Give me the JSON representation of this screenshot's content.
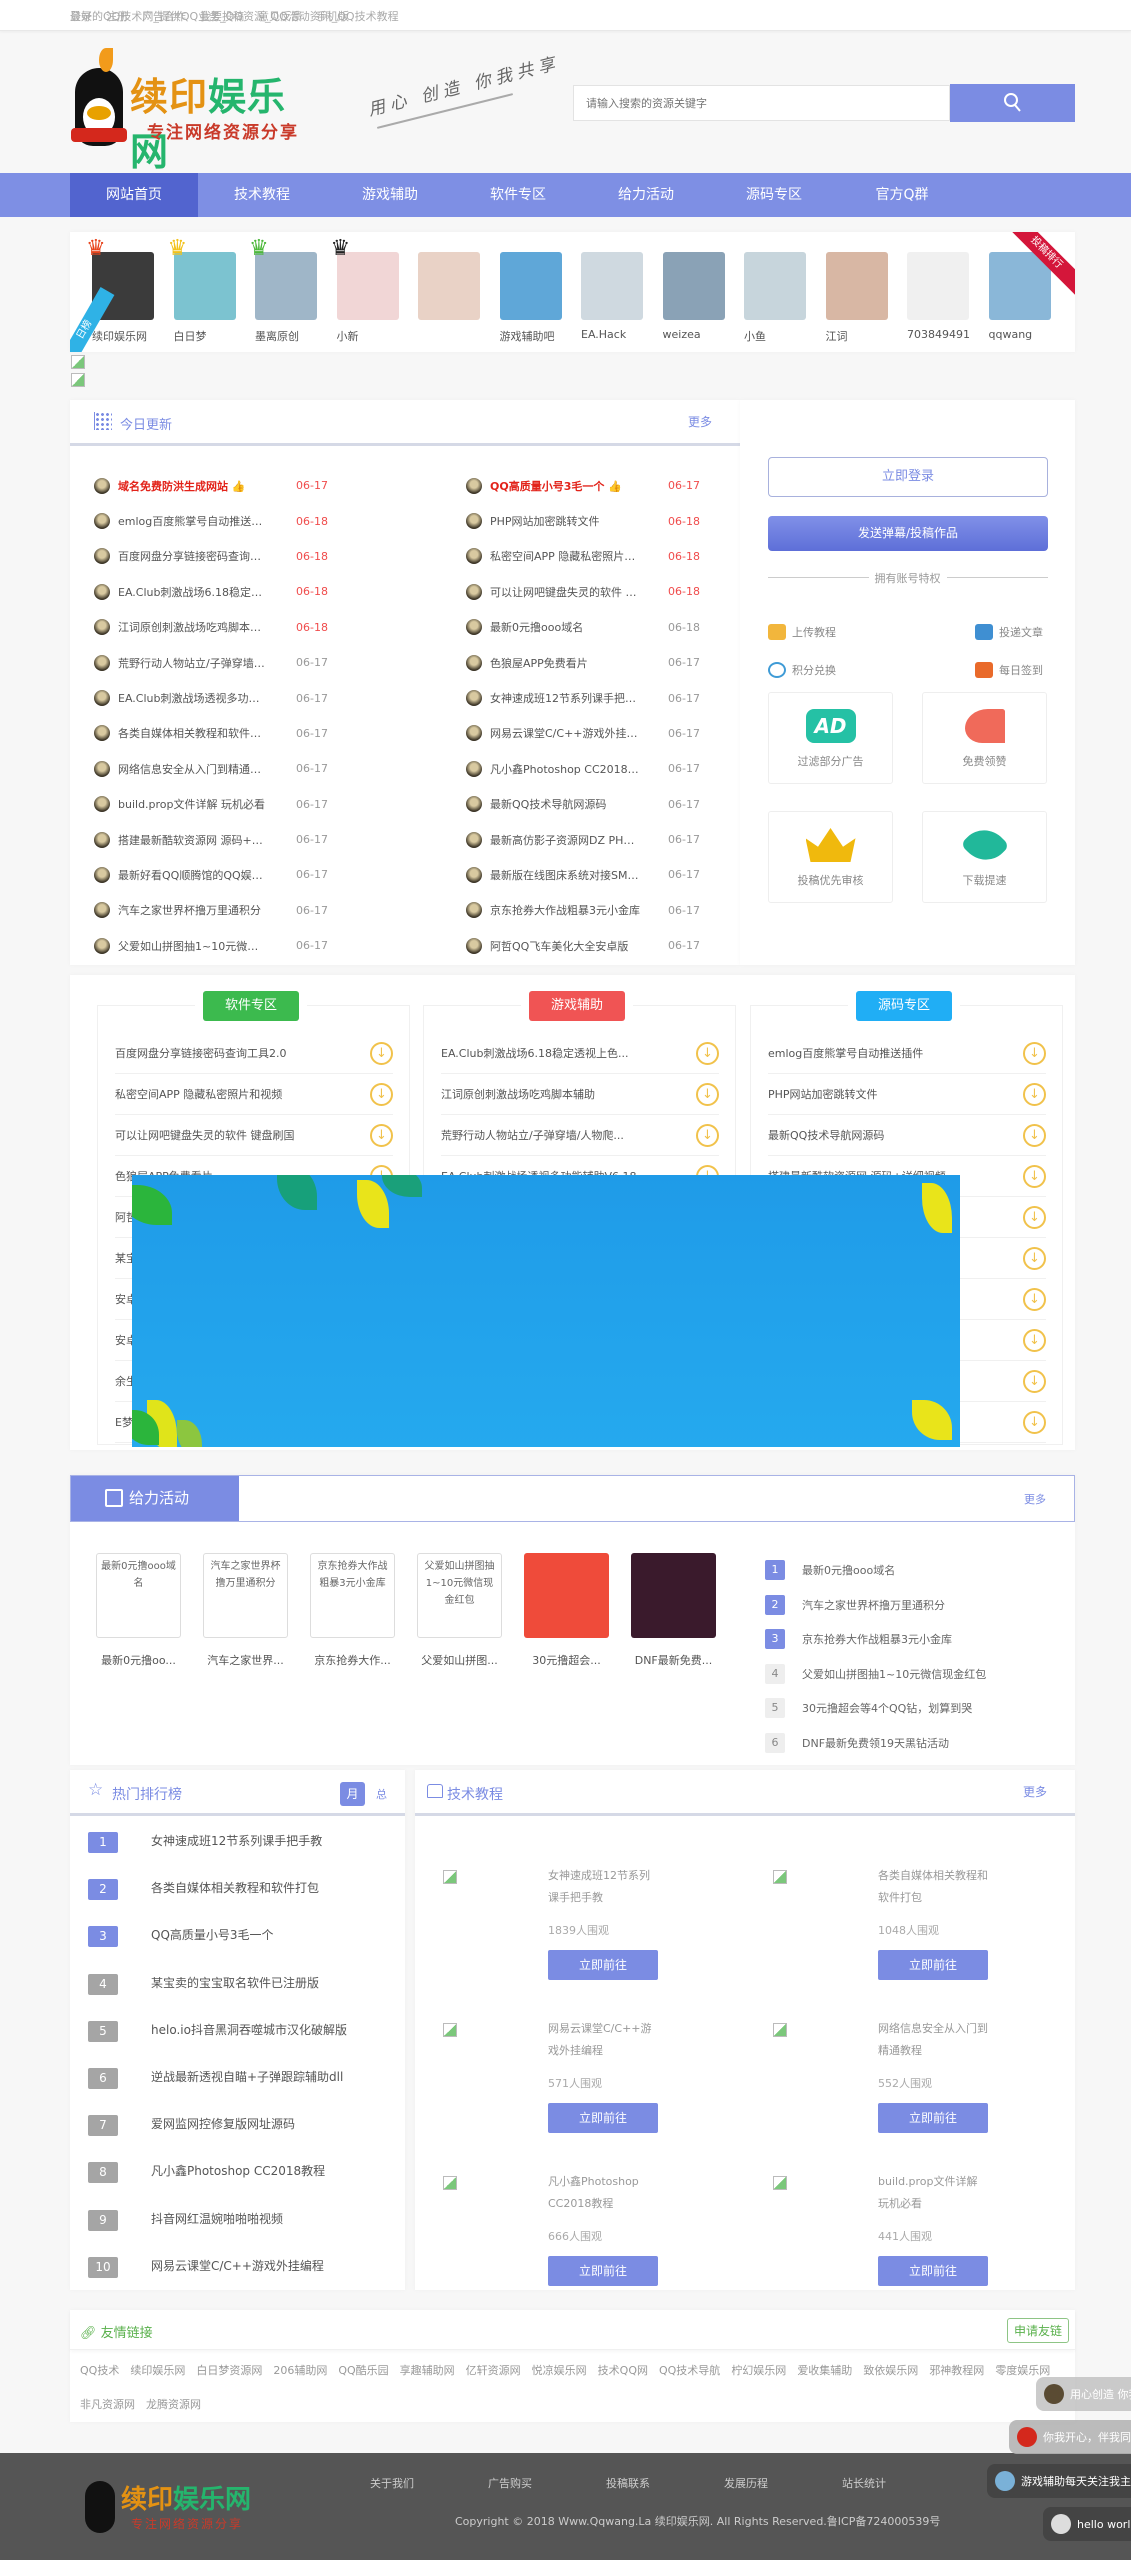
{
  "topbar": {
    "tagline": "最好的QQ技术网_提供QQ业务_QQ资源_QQ活动资讯_QQ技术教程",
    "links": [
      "登录",
      "注册",
      "广告合作",
      "我要投稿",
      "意见反馈",
      "手机版"
    ]
  },
  "header": {
    "logo_name": "续印娱乐网",
    "logo_sub": "专注网络资源分享",
    "slogan": "用心 创造 你我共享",
    "search_placeholder": "请输入搜索的资源关键字",
    "search_icon": "search-icon"
  },
  "nav": [
    "网站首页",
    "技术教程",
    "游戏辅助",
    "软件专区",
    "给力活动",
    "源码专区",
    "官方Q群"
  ],
  "colors": {
    "accent": "#7b8ce3",
    "nav_active": "#5264cf",
    "hot": "#e2231a",
    "software": "#3cba4e",
    "game": "#f05454",
    "source": "#20aef5"
  },
  "avatars": {
    "ribbon_right": "投稿排行",
    "ribbon_left": "日榜",
    "users": [
      {
        "name": "续印娱乐网"
      },
      {
        "name": "白日梦"
      },
      {
        "name": "墨离原创"
      },
      {
        "name": "小新"
      },
      {
        "name": ""
      },
      {
        "name": "游戏辅助吧"
      },
      {
        "name": "EA.Hack"
      },
      {
        "name": "weizea"
      },
      {
        "name": "小鱼"
      },
      {
        "name": "江词"
      },
      {
        "name": "703849491"
      },
      {
        "name": "qqwang"
      }
    ]
  },
  "today": {
    "title": "今日更新",
    "more": "更多",
    "left": [
      {
        "title": "域名免费防洪生成网站 👍",
        "date": "06-17",
        "hot": true,
        "red": true
      },
      {
        "title": "emlog百度熊掌号自动推送插件",
        "date": "06-18",
        "red": true
      },
      {
        "title": "百度网盘分享链接密码查询工具...",
        "date": "06-18",
        "red": true
      },
      {
        "title": "EA.Club刺激战场6.18稳定透视...",
        "date": "06-18",
        "red": true
      },
      {
        "title": "江词原创刺激战场吃鸡脚本辅助",
        "date": "06-18",
        "red": true
      },
      {
        "title": "荒野行动人物站立/子弹穿墙/人...",
        "date": "06-17"
      },
      {
        "title": "EA.Club刺激战场透视多功能辅...",
        "date": "06-17"
      },
      {
        "title": "各类自媒体相关教程和软件打包",
        "date": "06-17"
      },
      {
        "title": "网络信息安全从入门到精通教程",
        "date": "06-17"
      },
      {
        "title": "build.prop文件详解 玩机必看",
        "date": "06-17"
      },
      {
        "title": "搭建最新酷软资源网 源码+详细...",
        "date": "06-17"
      },
      {
        "title": "最新好看QQ顺腾馆的QQ娱乐...",
        "date": "06-17"
      },
      {
        "title": "汽车之家世界杯撸万里通积分",
        "date": "06-17"
      },
      {
        "title": "父爱如山拼图抽1~10元微信现...",
        "date": "06-17"
      }
    ],
    "right": [
      {
        "title": "QQ高质量小号3毛一个 👍",
        "date": "06-17",
        "hot": true,
        "red": true
      },
      {
        "title": "PHP网站加密跳转文件",
        "date": "06-18",
        "red": true
      },
      {
        "title": "私密空间APP 隐藏私密照片和...",
        "date": "06-18",
        "red": true
      },
      {
        "title": "可以让网吧键盘失灵的软件 键...",
        "date": "06-18",
        "red": true
      },
      {
        "title": "最新0元撸ooo域名",
        "date": "06-18"
      },
      {
        "title": "色狼屋APP免费看片",
        "date": "06-17"
      },
      {
        "title": "女神速成班12节系列课手把手教",
        "date": "06-17"
      },
      {
        "title": "网易云课堂C/C++游戏外挂编程",
        "date": "06-17"
      },
      {
        "title": "凡小鑫Photoshop CC2018教程",
        "date": "06-17"
      },
      {
        "title": "最新QQ技术导航网源码",
        "date": "06-17"
      },
      {
        "title": " 最新高仿影子资源网DZ PHP源码",
        "date": "06-17"
      },
      {
        "title": "最新版在线图床系统对接SM.M...",
        "date": "06-17"
      },
      {
        "title": "京东抢券大作战粗暴3元小金库",
        "date": "06-17"
      },
      {
        "title": "阿哲QQ飞车美化大全安卓版",
        "date": "06-17"
      }
    ]
  },
  "account": {
    "login": "立即登录",
    "post": "发送弹幕/投稿作品",
    "privilege_title": "拥有账号特权",
    "perks": [
      "上传教程",
      "投递文章",
      "积分兑换",
      "每日签到"
    ],
    "cards": [
      "过滤部分广告",
      "免费领赞",
      "投稿优先审核",
      "下载提速"
    ]
  },
  "zones": {
    "software": {
      "label": "软件专区",
      "items": [
        "百度网盘分享链接密码查询工具2.0",
        "私密空间APP 隐藏私密照片和视频",
        "可以让网吧键盘失灵的软件 键盘刷国",
        "色狼屋APP免费看片",
        "阿哲",
        "某宝",
        "安卓",
        "安卓",
        "余生",
        "E梦"
      ]
    },
    "game": {
      "label": "游戏辅助",
      "items": [
        "EA.Club刺激战场6.18稳定透视上色...",
        "江词原创刺激战场吃鸡脚本辅助",
        "荒野行动人物站立/子弹穿墙/人物爬...",
        "EA.Club刺激战场透视多功能辅助V6.18",
        "",
        "",
        "",
        "",
        "",
        ""
      ]
    },
    "source": {
      "label": "源码专区",
      "items": [
        "emlog百度熊掌号自动推送插件",
        "PHP网站加密跳转文件",
        "最新QQ技术导航网源码",
        "搭建最新酷软资源网 源码+详细视频...",
        "",
        "",
        "",
        "",
        "",
        ""
      ]
    }
  },
  "activity": {
    "title": "给力活动",
    "more": "更多",
    "thumbs": [
      {
        "alt": "最新0元撸ooo域名",
        "caption": "最新0元撸oo..."
      },
      {
        "alt": "汽车之家世界杯撸万里通积分",
        "caption": "汽车之家世界..."
      },
      {
        "alt": "京东抢券大作战粗暴3元小金库",
        "caption": "京东抢券大作..."
      },
      {
        "alt": "父爱如山拼图抽1~10元微信现金红包",
        "caption": "父爱如山拼图..."
      },
      {
        "alt": "",
        "caption": "30元撸超会..."
      },
      {
        "alt": "",
        "caption": "DNF最新免费..."
      }
    ],
    "list": [
      {
        "n": "1",
        "title": "最新0元撸ooo域名"
      },
      {
        "n": "2",
        "title": "汽车之家世界杯撸万里通积分"
      },
      {
        "n": "3",
        "title": "京东抢券大作战粗暴3元小金库"
      },
      {
        "n": "4",
        "title": "父爱如山拼图抽1~10元微信现金红包"
      },
      {
        "n": "5",
        "title": "30元撸超会等4个QQ钻，划算到哭"
      },
      {
        "n": "6",
        "title": "DNF最新免费领19天黑钻活动"
      }
    ]
  },
  "ranking": {
    "title": "热门排行榜",
    "tab_month": "月",
    "tab_total": "总",
    "items": [
      {
        "n": "1",
        "title": "女神速成班12节系列课手把手教"
      },
      {
        "n": "2",
        "title": "各类自媒体相关教程和软件打包"
      },
      {
        "n": "3",
        "title": "QQ高质量小号3毛一个"
      },
      {
        "n": "4",
        "title": "某宝卖的宝宝取名软件已注册版"
      },
      {
        "n": "5",
        "title": "helo.io抖音黑洞吞噬城市汉化破解版"
      },
      {
        "n": "6",
        "title": "逆战最新透视自瞄+子弹跟踪辅助dll"
      },
      {
        "n": "7",
        "title": "爱网监网控修复版网址源码"
      },
      {
        "n": "8",
        "title": "凡小鑫Photoshop CC2018教程"
      },
      {
        "n": "9",
        "title": "抖音网红温婉啪啪啪视频"
      },
      {
        "n": "10",
        "title": "网易云课堂C/C++游戏外挂编程"
      }
    ]
  },
  "tech": {
    "title": "技术教程",
    "more": "更多",
    "cards": [
      {
        "title": "女神速成班12节系列课手把手教",
        "views": "1839人围观",
        "button": "立即前往"
      },
      {
        "title": "各类自媒体相关教程和软件打包",
        "views": "1048人围观",
        "button": "立即前往"
      },
      {
        "title": "网易云课堂C/C++游戏外挂编程",
        "views": "571人围观",
        "button": "立即前往"
      },
      {
        "title": "网络信息安全从入门到精通教程",
        "views": "552人围观",
        "button": "立即前往"
      },
      {
        "title": "凡小鑫Photoshop CC2018教程",
        "views": "666人围观",
        "button": "立即前往"
      },
      {
        "title": "build.prop文件详解 玩机必看",
        "views": "441人围观",
        "button": "立即前往"
      }
    ]
  },
  "friends": {
    "title": "友情链接",
    "apply": "申请友链",
    "links": [
      "QQ技术",
      "续印娱乐网",
      "白日梦资源网",
      "206辅助网",
      "QQ酷乐园",
      "享趣辅助网",
      "亿轩资源网",
      "悦凉娱乐网",
      "技术QQ网",
      "QQ技术导航",
      "柠幻娱乐网",
      "爱收集辅助",
      "致依娱乐网",
      "邪神教程网",
      "零度娱乐网",
      "非凡资源网",
      "龙腾资源网"
    ]
  },
  "footer": {
    "links": [
      "关于我们",
      "广告购买",
      "投稿联系",
      "发展历程",
      "站长统计"
    ],
    "copyright": "Copyright © 2018 Www.Qqwang.La 续印娱乐网. All Rights Reserved.鲁ICP备724000539号"
  },
  "danmaku": [
    "用心创造 你我共享！",
    "你我开心，伴我同行",
    "游戏辅助每天关注我主页",
    "hello world"
  ]
}
